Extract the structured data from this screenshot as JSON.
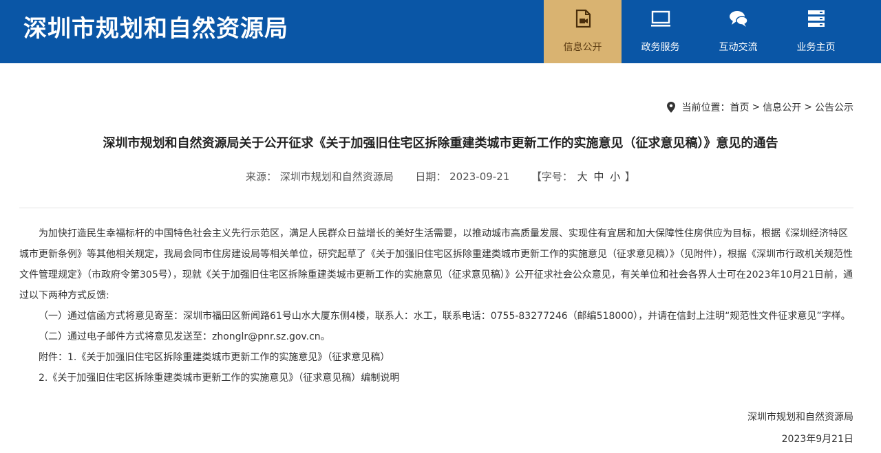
{
  "header": {
    "site_title": "深圳市规划和自然资源局",
    "nav": [
      {
        "label": "信息公开",
        "icon": "document-video-icon",
        "active": true
      },
      {
        "label": "政务服务",
        "icon": "monitor-icon",
        "active": false
      },
      {
        "label": "互动交流",
        "icon": "chat-bubbles-icon",
        "active": false
      },
      {
        "label": "业务主页",
        "icon": "server-stack-icon",
        "active": false
      }
    ],
    "brand_color": "#0a56a6",
    "active_color": "#d9b371"
  },
  "breadcrumb": {
    "prefix": "当前位置：",
    "items": [
      "首页",
      "信息公开",
      "公告公示"
    ],
    "separator": ">"
  },
  "article": {
    "title": "深圳市规划和自然资源局关于公开征求《关于加强旧住宅区拆除重建类城市更新工作的实施意见（征求意见稿）》意见的通告",
    "meta": {
      "source_label": "来源：",
      "source": "深圳市规划和自然资源局",
      "date_label": "日期：",
      "date": "2023-09-21",
      "font_size_open": "【字号：",
      "font_sizes": [
        "大",
        "中",
        "小"
      ],
      "font_size_close": "】"
    },
    "paragraphs": [
      "为加快打造民生幸福标杆的中国特色社会主义先行示范区，满足人民群众日益增长的美好生活需要，以推动城市高质量发展、实现住有宜居和加大保障性住房供应为目标，根据《深圳经济特区城市更新条例》等其他相关规定，我局会同市住房建设局等相关单位，研究起草了《关于加强旧住宅区拆除重建类城市更新工作的实施意见（征求意见稿）》（见附件），根据《深圳市行政机关规范性文件管理规定》（市政府令第305号），现就《关于加强旧住宅区拆除重建类城市更新工作的实施意见（征求意见稿）》公开征求社会公众意见，有关单位和社会各界人士可在2023年10月21日前，通过以下两种方式反馈:",
      "（一）通过信函方式将意见寄至：深圳市福田区新闻路61号山水大厦东侧4楼，联系人：水工，联系电话：0755-83277246（邮编518000），并请在信封上注明“规范性文件征求意见”字样。",
      "（二）通过电子邮件方式将意见发送至：zhonglr@pnr.sz.gov.cn。",
      "附件：1.《关于加强旧住宅区拆除重建类城市更新工作的实施意见》（征求意见稿）",
      "2.《关于加强旧住宅区拆除重建类城市更新工作的实施意见》（征求意见稿）编制说明"
    ],
    "signature_org": "深圳市规划和自然资源局",
    "signature_date": "2023年9月21日"
  }
}
